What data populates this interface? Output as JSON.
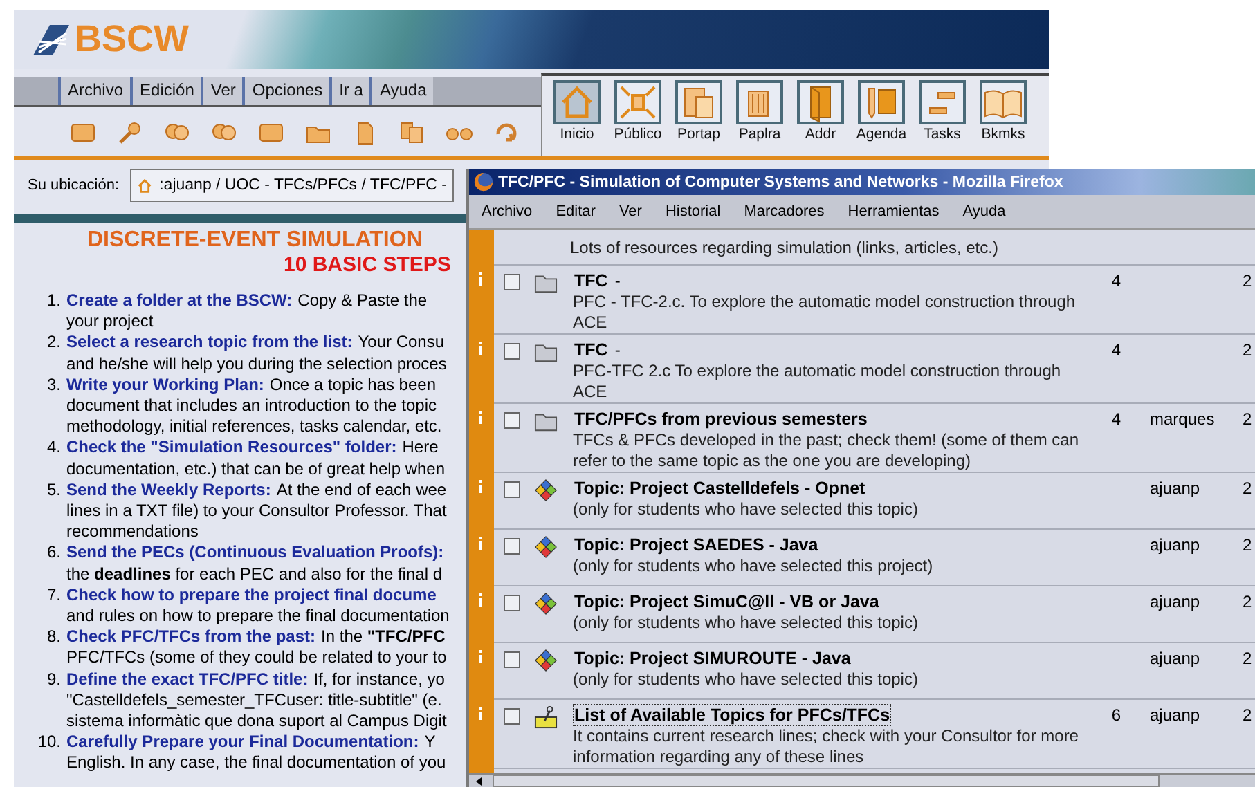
{
  "bscw": {
    "logo": "BSCW",
    "menu": [
      "Archivo",
      "Edición",
      "Ver",
      "Opciones",
      "Ir a",
      "Ayuda"
    ],
    "tiles": [
      {
        "label": "Inicio",
        "selected": true
      },
      {
        "label": "Público",
        "selected": false
      },
      {
        "label": "Portap",
        "selected": false
      },
      {
        "label": "Paplra",
        "selected": false
      },
      {
        "label": "Addr",
        "selected": false
      },
      {
        "label": "Agenda",
        "selected": false
      },
      {
        "label": "Tasks",
        "selected": false
      },
      {
        "label": "Bkmks",
        "selected": false
      }
    ],
    "location": {
      "label": "Su ubicación:",
      "path": ":ajuanp / UOC - TFCs/PFCs / TFC/PFC -"
    },
    "title": "DISCRETE-EVENT SIMULATION",
    "subtitle": "10 BASIC STEPS",
    "steps": [
      {
        "number": "1.",
        "lead": "Create a folder at the BSCW:",
        "rest": "Copy & Paste the",
        "lines": [
          "your project"
        ]
      },
      {
        "number": "2.",
        "lead": "Select a research topic from the list:",
        "rest": "Your Consu",
        "lines": [
          "and he/she will help you during the selection proces"
        ]
      },
      {
        "number": "3.",
        "lead": "Write your Working Plan:",
        "rest": "Once a topic has been",
        "lines": [
          "document that includes an introduction to the topic",
          "methodology, initial references, tasks calendar, etc."
        ]
      },
      {
        "number": "4.",
        "lead": "Check the \"Simulation Resources\" folder:",
        "rest": "Here",
        "lines": [
          "documentation, etc.) that can be of great help when"
        ]
      },
      {
        "number": "5.",
        "lead": "Send the Weekly Reports:",
        "rest": "At the end of each wee",
        "lines": [
          "lines in a TXT file) to your Consultor Professor. That",
          "recommendations"
        ]
      },
      {
        "number": "6.",
        "lead": "Send the PECs (Continuous Evaluation Proofs):",
        "lines": [
          "the **deadlines** for each PEC and also for the final d"
        ]
      },
      {
        "number": "7.",
        "lead": "Check how to prepare the project final docume",
        "lines": [
          "and rules on how to prepare the final documentation"
        ]
      },
      {
        "number": "8.",
        "lead": "Check PFC/TFCs from the past:",
        "rest": "In the **\"TFC/PFC**",
        "lines": [
          "PFC/TFCs (some of they could be related to your to"
        ]
      },
      {
        "number": "9.",
        "lead": "Define the exact TFC/PFC title:",
        "rest": "If, for instance, yo",
        "lines": [
          "\"Castelldefels_semester_TFCuser: title-subtitle\" (e.",
          "sistema informàtic que dona suport al Campus Digit"
        ]
      },
      {
        "number": "10.",
        "lead": "Carefully Prepare your Final Documentation:",
        "rest": "Y",
        "lines": [
          "English. In any case, the final documentation of you"
        ]
      }
    ]
  },
  "firefox": {
    "title": "TFC/PFC - Simulation of Computer Systems and Networks - Mozilla Firefox",
    "menu": [
      "Archivo",
      "Editar",
      "Ver",
      "Historial",
      "Marcadores",
      "Herramientas",
      "Ayuda"
    ],
    "top_text": "Lots of resources regarding simulation (links, articles, etc.)",
    "rows": [
      {
        "kind": "folder",
        "checked": false,
        "focused": false,
        "title": "TFC",
        "title_suffix": "-",
        "description": "PFC - TFC-2.c. To explore the automatic model construction through ACE",
        "column_3": "4",
        "column_5": "2"
      },
      {
        "kind": "folder",
        "checked": false,
        "focused": false,
        "title": "TFC",
        "title_suffix": "-",
        "description": "PFC-TFC 2.c To explore the automatic model construction through ACE",
        "column_3": "4",
        "column_5": "2"
      },
      {
        "kind": "folder",
        "checked": false,
        "focused": false,
        "title": "TFC/PFCs from previous semesters",
        "description": "TFCs & PFCs developed in the past; check them! (some of them can refer to the same topic as the one you are developing)",
        "column_3": "4",
        "owner": "marques",
        "column_5": "2"
      },
      {
        "kind": "topic",
        "checked": false,
        "focused": false,
        "title": "Topic: Project Castelldefels - Opnet",
        "description": "(only for students who have selected this topic)",
        "owner": "ajuanp",
        "column_5": "2"
      },
      {
        "kind": "topic",
        "checked": false,
        "focused": false,
        "title": "Topic: Project SAEDES - Java",
        "description": "(only for students who have selected this project)",
        "owner": "ajuanp",
        "column_5": "2"
      },
      {
        "kind": "topic",
        "checked": false,
        "focused": false,
        "title": "Topic: Project SimuC@ll - VB or Java",
        "description": "(only for students who have selected this topic)",
        "owner": "ajuanp",
        "column_5": "2"
      },
      {
        "kind": "topic",
        "checked": false,
        "focused": false,
        "title": "Topic: Project SIMUROUTE - Java",
        "description": "(only for students who have selected this topic)",
        "owner": "ajuanp",
        "column_5": "2"
      },
      {
        "kind": "note",
        "checked": false,
        "focused": true,
        "title": "List of Available Topics for PFCs/TFCs",
        "description": "It contains current research lines; check with your Consultor for more information regarding any of these lines",
        "column_3": "6",
        "owner": "ajuanp",
        "column_5": "2"
      }
    ]
  }
}
